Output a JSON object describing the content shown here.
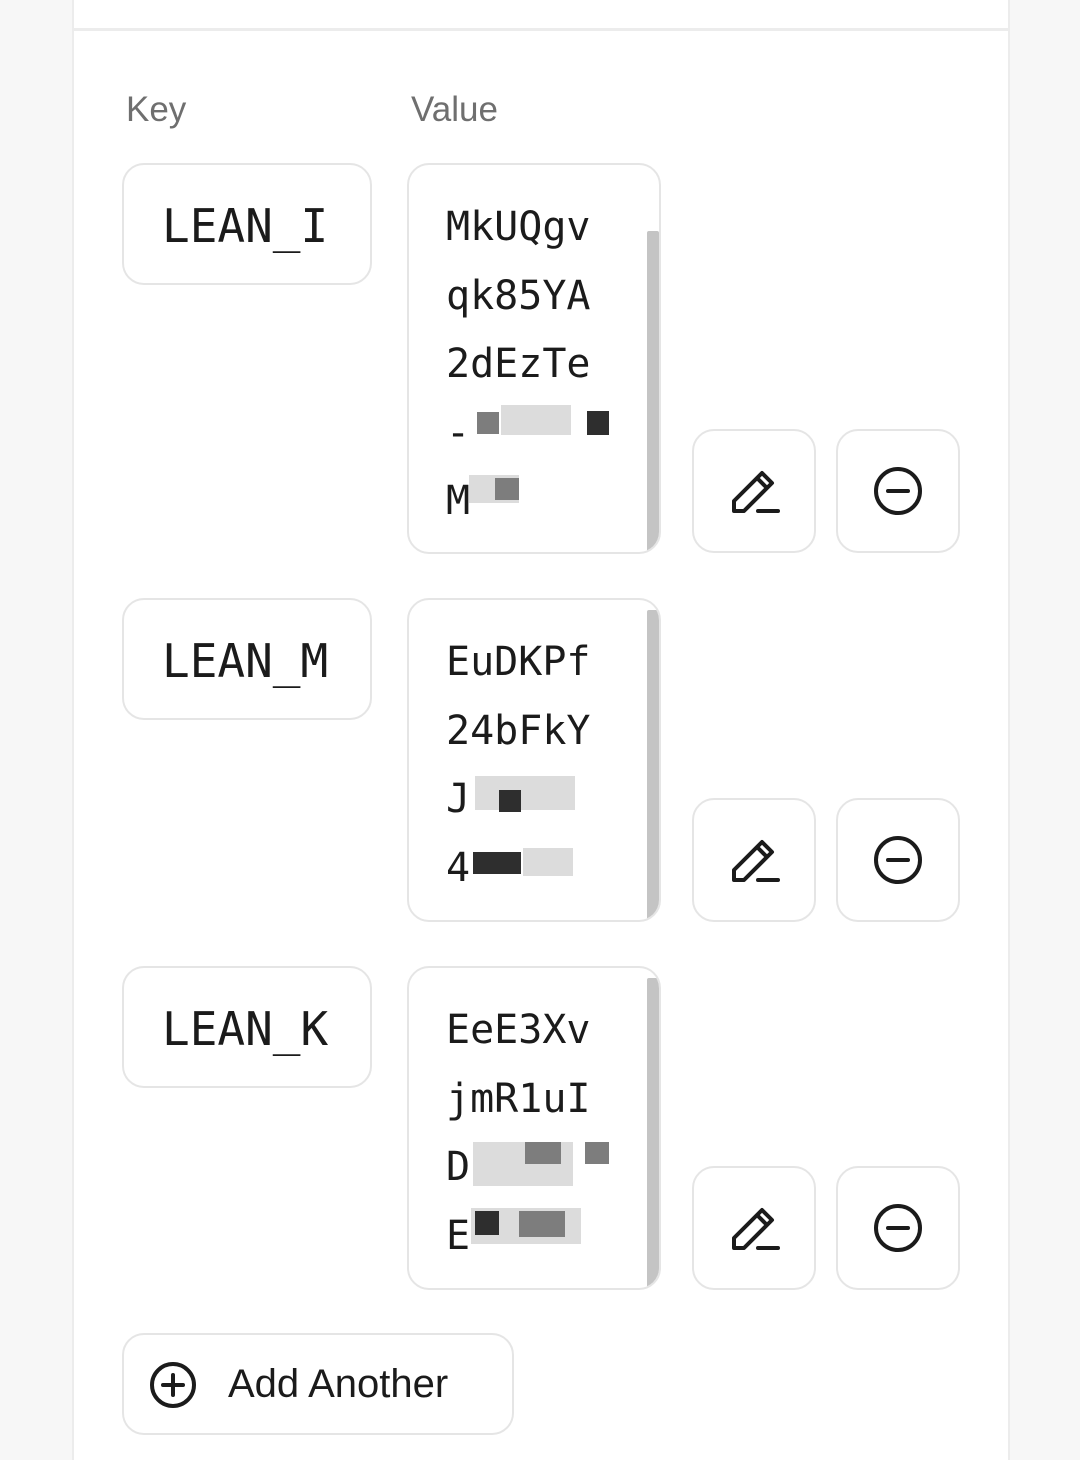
{
  "columns": {
    "key_label": "Key",
    "value_label": "Value"
  },
  "rows": [
    {
      "key": "LEAN_I",
      "value_lines": [
        "MkUQgv",
        "qk85YA",
        "2dEzTe",
        "-",
        "M"
      ],
      "edit_icon": "pencil-icon",
      "remove_icon": "minus-circle-icon"
    },
    {
      "key": "LEAN_M",
      "value_lines": [
        "EuDKPf",
        "24bFkY",
        "J",
        "4"
      ],
      "edit_icon": "pencil-icon",
      "remove_icon": "minus-circle-icon"
    },
    {
      "key": "LEAN_K",
      "value_lines": [
        "EeE3Xv",
        "jmR1uI",
        "D",
        "E"
      ],
      "edit_icon": "pencil-icon",
      "remove_icon": "minus-circle-icon"
    }
  ],
  "add_button": {
    "label": "Add Another",
    "icon": "plus-circle-icon"
  },
  "colors": {
    "panel_bg": "#ffffff",
    "page_bg": "#f7f7f7",
    "border": "#e5e5e5",
    "text": "#1b1b1b",
    "muted": "#6f6f6f"
  }
}
